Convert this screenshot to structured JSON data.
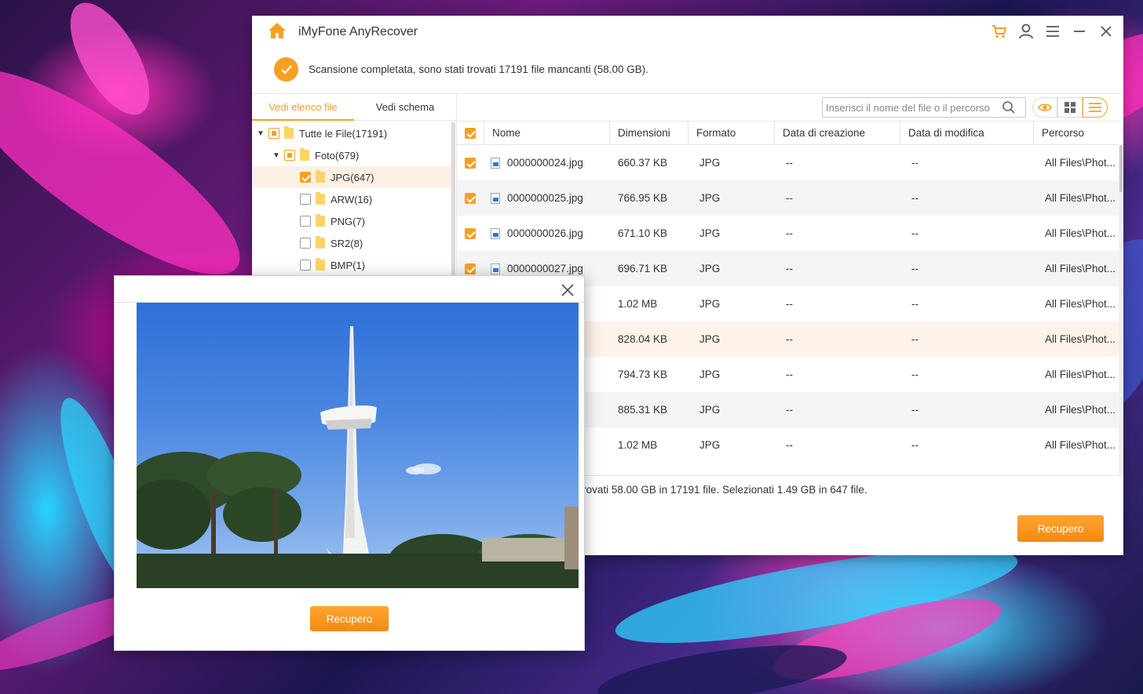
{
  "app": {
    "title": "iMyFone AnyRecover",
    "accent": "#f5a022"
  },
  "status": {
    "message": "Scansione completata, sono stati trovati 17191 file mancanti (58.00 GB)."
  },
  "tabs": [
    {
      "label": "Vedi elenco file",
      "active": true
    },
    {
      "label": "Vedi schema",
      "active": false
    }
  ],
  "tree": [
    {
      "label": "Tutte le File(17191)",
      "state": "partial"
    },
    {
      "label": "Foto(679)",
      "state": "partial"
    },
    {
      "label": "JPG(647)",
      "state": "checked"
    },
    {
      "label": "ARW(16)",
      "state": "unchecked"
    },
    {
      "label": "PNG(7)",
      "state": "unchecked"
    },
    {
      "label": "SR2(8)",
      "state": "unchecked"
    },
    {
      "label": "BMP(1)",
      "state": "unchecked"
    }
  ],
  "search": {
    "placeholder": "Inserisci il nome del file o il percorso"
  },
  "view_icons": [
    "eye-icon",
    "grid-icon",
    "list-icon"
  ],
  "columns": [
    "Nome",
    "Dimensioni",
    "Formato",
    "Data di creazione",
    "Data di modifica",
    "Percorso"
  ],
  "files": [
    {
      "name": "0000000024.jpg",
      "size": "660.37 KB",
      "format": "JPG",
      "created": "--",
      "modified": "--",
      "path": "All Files\\Phot..."
    },
    {
      "name": "0000000025.jpg",
      "size": "766.95 KB",
      "format": "JPG",
      "created": "--",
      "modified": "--",
      "path": "All Files\\Phot..."
    },
    {
      "name": "0000000026.jpg",
      "size": "671.10 KB",
      "format": "JPG",
      "created": "--",
      "modified": "--",
      "path": "All Files\\Phot..."
    },
    {
      "name": "0000000027.jpg",
      "size": "696.71 KB",
      "format": "JPG",
      "created": "--",
      "modified": "--",
      "path": "All Files\\Phot..."
    },
    {
      "name": "g",
      "size": "1.02 MB",
      "format": "JPG",
      "created": "--",
      "modified": "--",
      "path": "All Files\\Phot..."
    },
    {
      "name": "g",
      "size": "828.04 KB",
      "format": "JPG",
      "created": "--",
      "modified": "--",
      "path": "All Files\\Phot..."
    },
    {
      "name": "g",
      "size": "794.73 KB",
      "format": "JPG",
      "created": "--",
      "modified": "--",
      "path": "All Files\\Phot..."
    },
    {
      "name": "g",
      "size": "885.31 KB",
      "format": "JPG",
      "created": "--",
      "modified": "--",
      "path": "All Files\\Phot..."
    },
    {
      "name": "g",
      "size": "1.02 MB",
      "format": "JPG",
      "created": "--",
      "modified": "--",
      "path": "All Files\\Phot..."
    }
  ],
  "footer": {
    "summary": "Trovati 58.00 GB in 17191 file. Selezionati 1.49 GB in 647 file.",
    "recover_label": "Recupero"
  },
  "preview": {
    "recover_label": "Recupero"
  }
}
